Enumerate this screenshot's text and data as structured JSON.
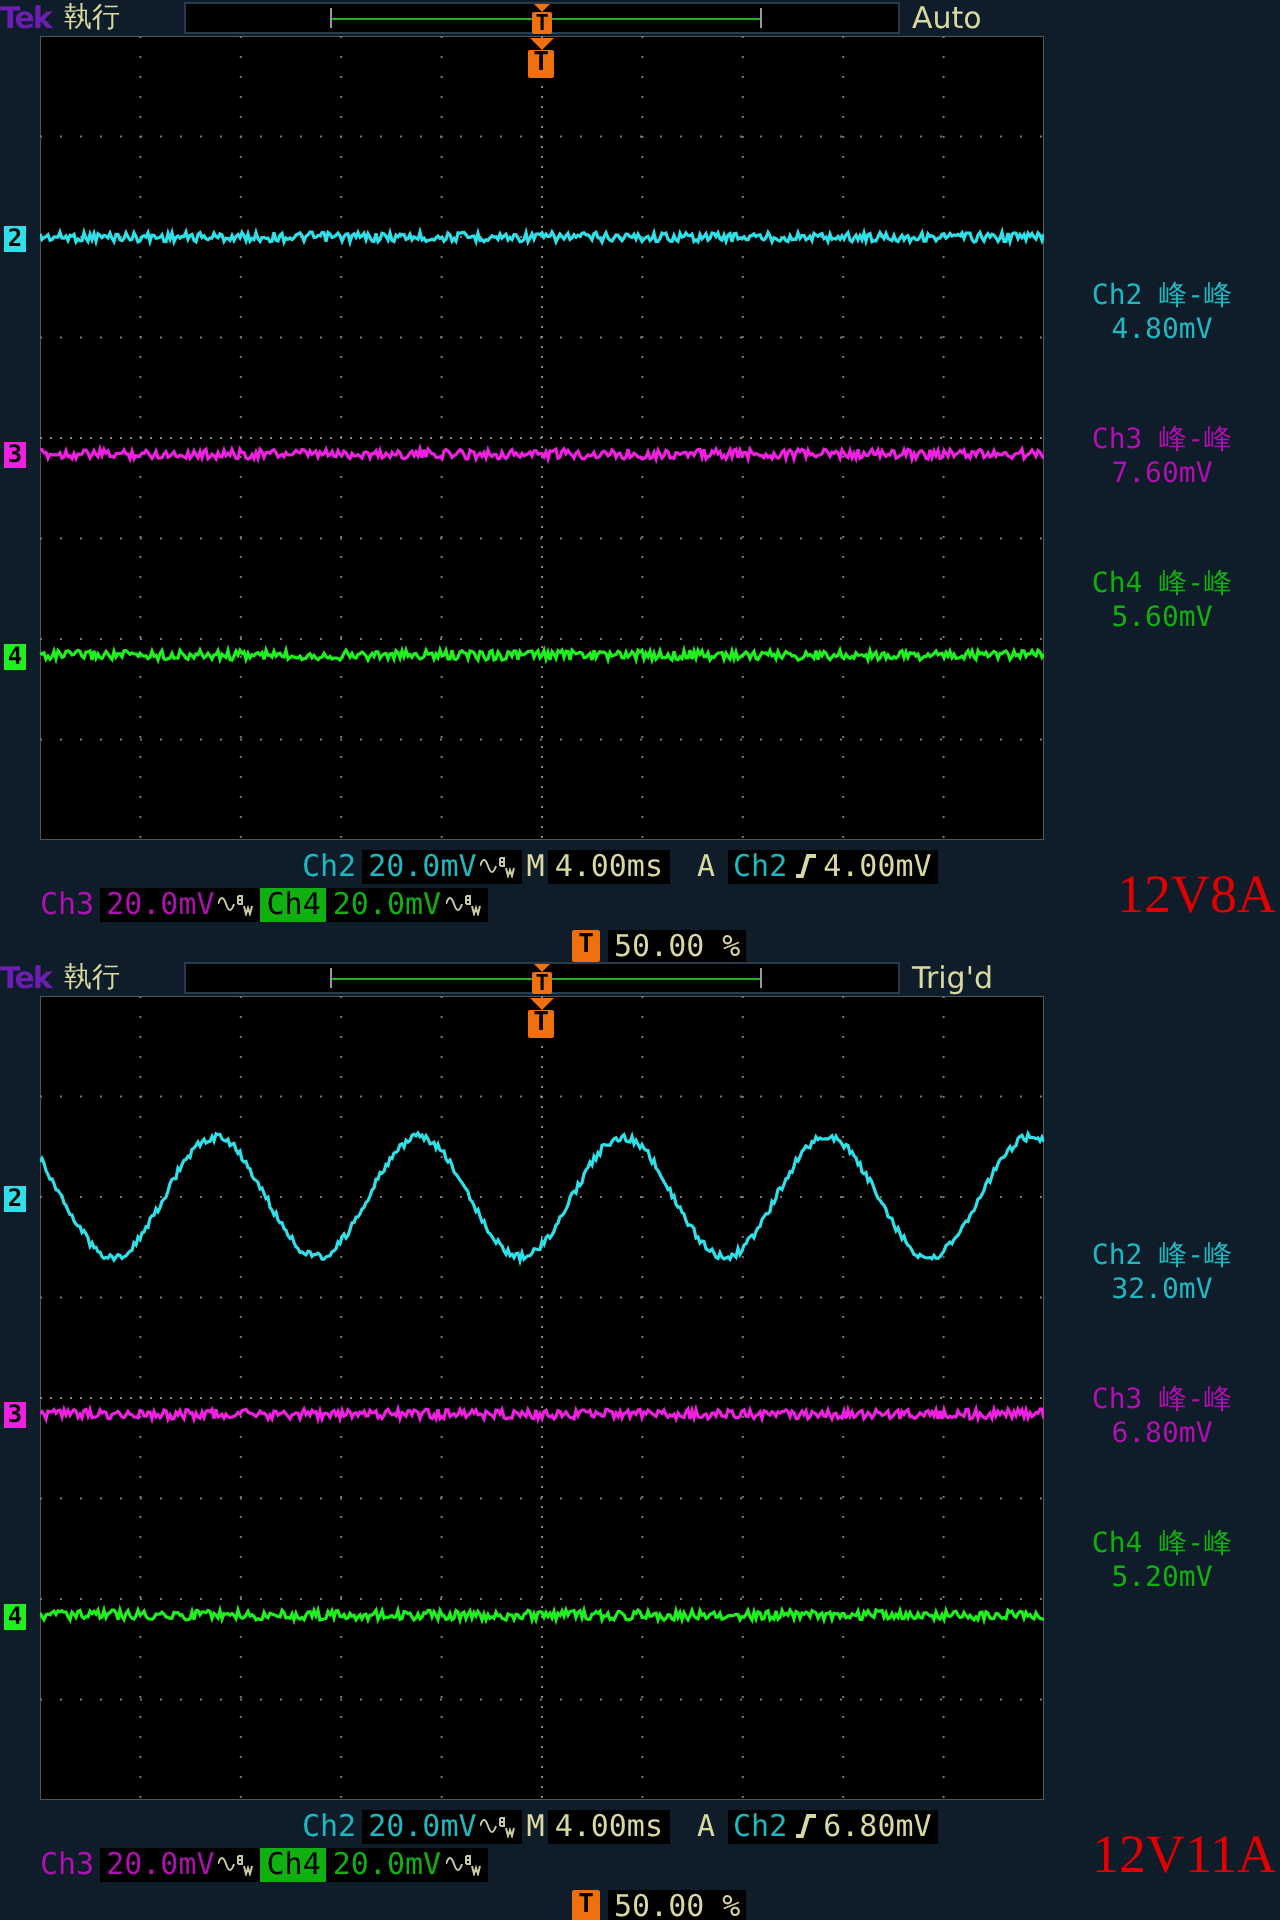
{
  "panels": [
    {
      "brand": "Tek",
      "run_state": "執行",
      "record_marker": "T",
      "trigger_status": "Auto",
      "trigger_marker": "T",
      "channels": [
        {
          "marker": "2",
          "color": "#30e0e8",
          "kind": "noise"
        },
        {
          "marker": "3",
          "color": "#f020e0",
          "kind": "noise"
        },
        {
          "marker": "4",
          "color": "#20f020",
          "kind": "noise"
        }
      ],
      "readings": [
        {
          "title": "Ch2 峰-峰",
          "value": "4.80mV",
          "color": "#20b8c0"
        },
        {
          "title": "Ch3 峰-峰",
          "value": "7.60mV",
          "color": "#b010b0"
        },
        {
          "title": "Ch4 峰-峰",
          "value": "5.60mV",
          "color": "#10b010"
        }
      ],
      "vertical": [
        {
          "channel": "Ch2",
          "scale": "20.0mV",
          "bw_limit": true,
          "selected": false,
          "color": "#20b8c0"
        },
        {
          "channel": "Ch3",
          "scale": "20.0mV",
          "bw_limit": true,
          "selected": false,
          "color": "#b010b0"
        },
        {
          "channel": "Ch4",
          "scale": "20.0mV",
          "bw_limit": true,
          "selected": true,
          "color": "#10b010"
        }
      ],
      "timebase": {
        "prefix": "M",
        "value": "4.00ms"
      },
      "trigger": {
        "mode": "A",
        "source": "Ch2",
        "threshold": "4.00mV"
      },
      "position": {
        "marker": "T",
        "value": "50.00 %"
      },
      "label": "12V8A"
    },
    {
      "brand": "Tek",
      "run_state": "執行",
      "record_marker": "T",
      "trigger_status": "Trig'd",
      "trigger_marker": "T",
      "channels": [
        {
          "marker": "2",
          "color": "#30e0e8",
          "kind": "sine"
        },
        {
          "marker": "3",
          "color": "#f020e0",
          "kind": "noise"
        },
        {
          "marker": "4",
          "color": "#20f020",
          "kind": "noise"
        }
      ],
      "readings": [
        {
          "title": "Ch2 峰-峰",
          "value": "32.0mV",
          "color": "#20b8c0"
        },
        {
          "title": "Ch3 峰-峰",
          "value": "6.80mV",
          "color": "#b010b0"
        },
        {
          "title": "Ch4 峰-峰",
          "value": "5.20mV",
          "color": "#10b010"
        }
      ],
      "vertical": [
        {
          "channel": "Ch2",
          "scale": "20.0mV",
          "bw_limit": true,
          "selected": false,
          "color": "#20b8c0"
        },
        {
          "channel": "Ch3",
          "scale": "20.0mV",
          "bw_limit": true,
          "selected": false,
          "color": "#b010b0"
        },
        {
          "channel": "Ch4",
          "scale": "20.0mV",
          "bw_limit": true,
          "selected": true,
          "color": "#10b010"
        }
      ],
      "timebase": {
        "prefix": "M",
        "value": "4.00ms"
      },
      "trigger": {
        "mode": "A",
        "source": "Ch2",
        "threshold": "6.80mV"
      },
      "position": {
        "marker": "T",
        "value": "50.00 %"
      },
      "label": "12V11A"
    }
  ]
}
